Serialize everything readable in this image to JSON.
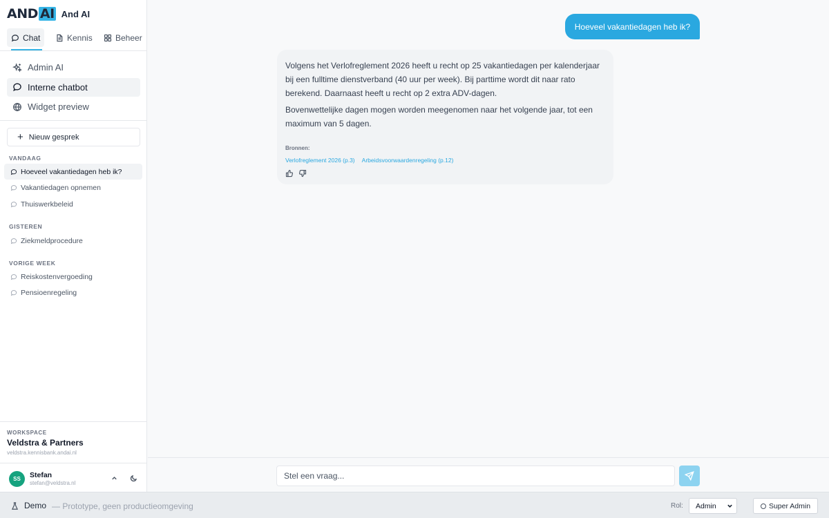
{
  "brand": {
    "logo_and": "AND",
    "logo_ai": "AI",
    "name": "And AI",
    "accent": "#35b4e6"
  },
  "top_tabs": [
    {
      "label": "Chat",
      "icon": "chat-bubble-icon",
      "active": true
    },
    {
      "label": "Kennis",
      "icon": "document-icon"
    },
    {
      "label": "Beheer",
      "icon": "grid-icon"
    }
  ],
  "modes": [
    {
      "label": "Admin AI",
      "icon": "sparkles-icon"
    },
    {
      "label": "Interne chatbot",
      "icon": "chat-bubble-icon",
      "active": true
    },
    {
      "label": "Widget preview",
      "icon": "globe-icon"
    }
  ],
  "new_chat_label": "Nieuw gesprek",
  "history": {
    "today_label": "VANDAAG",
    "today": [
      "Hoeveel vakantiedagen heb ik?",
      "Vakantiedagen opnemen",
      "Thuiswerkbeleid"
    ],
    "yesterday_label": "GISTEREN",
    "yesterday": [
      "Ziekmeldprocedure"
    ],
    "last_week_label": "VORIGE WEEK",
    "last_week": [
      "Reiskostenvergoeding",
      "Pensioenregeling"
    ]
  },
  "workspace": {
    "label": "WORKSPACE",
    "name": "Veldstra & Partners",
    "domain": "veldstra.kennisbank.andai.nl"
  },
  "user": {
    "initials": "SS",
    "name": "Stefan",
    "email": "stefan@veldstra.nl",
    "avatar_color": "#16a37f"
  },
  "chat": {
    "user_message": "Hoeveel vakantiedagen heb ik?",
    "ai_paragraphs": [
      "Volgens het Verlofreglement 2026 heeft u recht op 25 vakantiedagen per kalenderjaar bij een fulltime dienstverband (40 uur per week). Bij parttime wordt dit naar rato berekend. Daarnaast heeft u recht op 2 extra ADV-dagen.",
      "Bovenwettelijke dagen mogen worden meegenomen naar het volgende jaar, tot een maximum van 5 dagen."
    ],
    "sources_label": "Bronnen:",
    "sources": [
      "Verlofreglement 2026 (p.3)",
      "Arbeidsvoorwaardenregeling (p.12)"
    ],
    "input_placeholder": "Stel een vraag...",
    "bubble_color": "#2aa8e0"
  },
  "demo_bar": {
    "title": "Demo",
    "subtitle": "— Prototype, geen productieomgeving",
    "role_label": "Rol:",
    "role_value": "Admin",
    "super_admin_label": "Super Admin"
  }
}
